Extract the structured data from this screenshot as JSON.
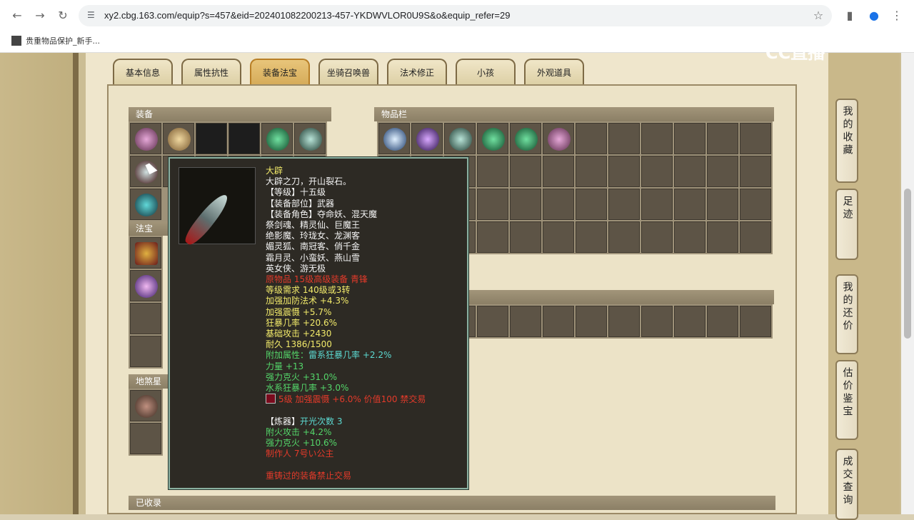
{
  "browser": {
    "url": "xy2.cbg.163.com/equip?s=457&eid=202401082200213-457-YKDWVLOR0U9S&o&equip_refer=29",
    "bookmark": "贵重物品保护_新手..."
  },
  "tabs": [
    "基本信息",
    "属性抗性",
    "装备法宝",
    "坐骑召唤兽",
    "法术修正",
    "小孩",
    "外观道具"
  ],
  "active_tab": "装备法宝",
  "sections": {
    "equipment": "装备",
    "inventory": "物品栏",
    "fabao": "法宝",
    "dijiang": "地煞星",
    "collected": "已收录"
  },
  "right_tabs": [
    "我的收藏",
    "足迹",
    "我的还价",
    "估价鉴宝",
    "成交查询"
  ],
  "watermark": "CC直播",
  "tooltip": {
    "name": "大辟",
    "desc": "大辟之刀，开山裂石。",
    "level": "【等级】十五级",
    "slot": "【装备部位】武器",
    "roles_label": "【装备角色】夺命妖、混天魔",
    "roles": [
      "祭剑魂、精灵仙、巨魔王",
      "绝影魔、玲珑女、龙渊客",
      "媚灵狐、南冠客、俏千金",
      "霜月灵、小蛮妖、燕山雪",
      "英女侠、游无极"
    ],
    "source": "原物品 15级高级装备 青锋",
    "requirement": "等级需求 140级或3转",
    "stats": [
      "加强加防法术 +4.3%",
      "加强震慑 +5.7%",
      "狂暴几率 +20.6%",
      "基础攻击 +2430"
    ],
    "durability": "耐久 1386/1500",
    "extra_label": "附加属性：",
    "extra_value": "雷系狂暴几率 +2.2%",
    "extra_stats": [
      "力量 +13",
      "强力克火 +31.0%",
      "水系狂暴几率 +3.0%"
    ],
    "gem": "5级 加强震慑 +6.0% 价值100 禁交易",
    "refine_label": "【炼器】",
    "refine_value": "开光次数 3",
    "refine_stats": [
      "附火攻击 +4.2%",
      "强力克火 +10.6%"
    ],
    "maker": "制作人 7号い公主",
    "warning": "重铸过的装备禁止交易"
  }
}
